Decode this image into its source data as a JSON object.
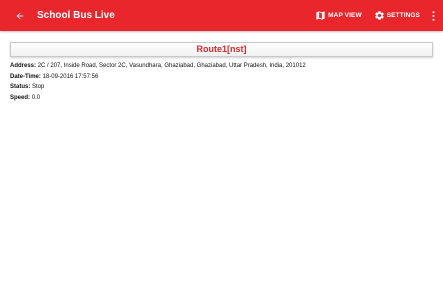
{
  "appbar": {
    "title": "School Bus Live",
    "map_view_label": "MAP VIEW",
    "settings_label": "SETTINGS",
    "color": "#e8262c"
  },
  "route": {
    "name": "Route1[nst]",
    "color": "#d92a2a"
  },
  "details": {
    "address_label": "Address:",
    "address_value": "2C / 207, Inside Road, Sector 2C, Vasundhara, Ghaziabad, Ghaziabad, Uttar Pradesh, India, 201012",
    "datetime_label": "Date-Time:",
    "datetime_value": "18-09-2016 17:57:56",
    "status_label": "Status:",
    "status_value": "Stop",
    "speed_label": "Speed:",
    "speed_value": "0.0"
  },
  "icons": {
    "back": "arrow-back-icon",
    "map": "map-icon",
    "settings": "gear-icon",
    "overflow": "more-vert-icon"
  }
}
